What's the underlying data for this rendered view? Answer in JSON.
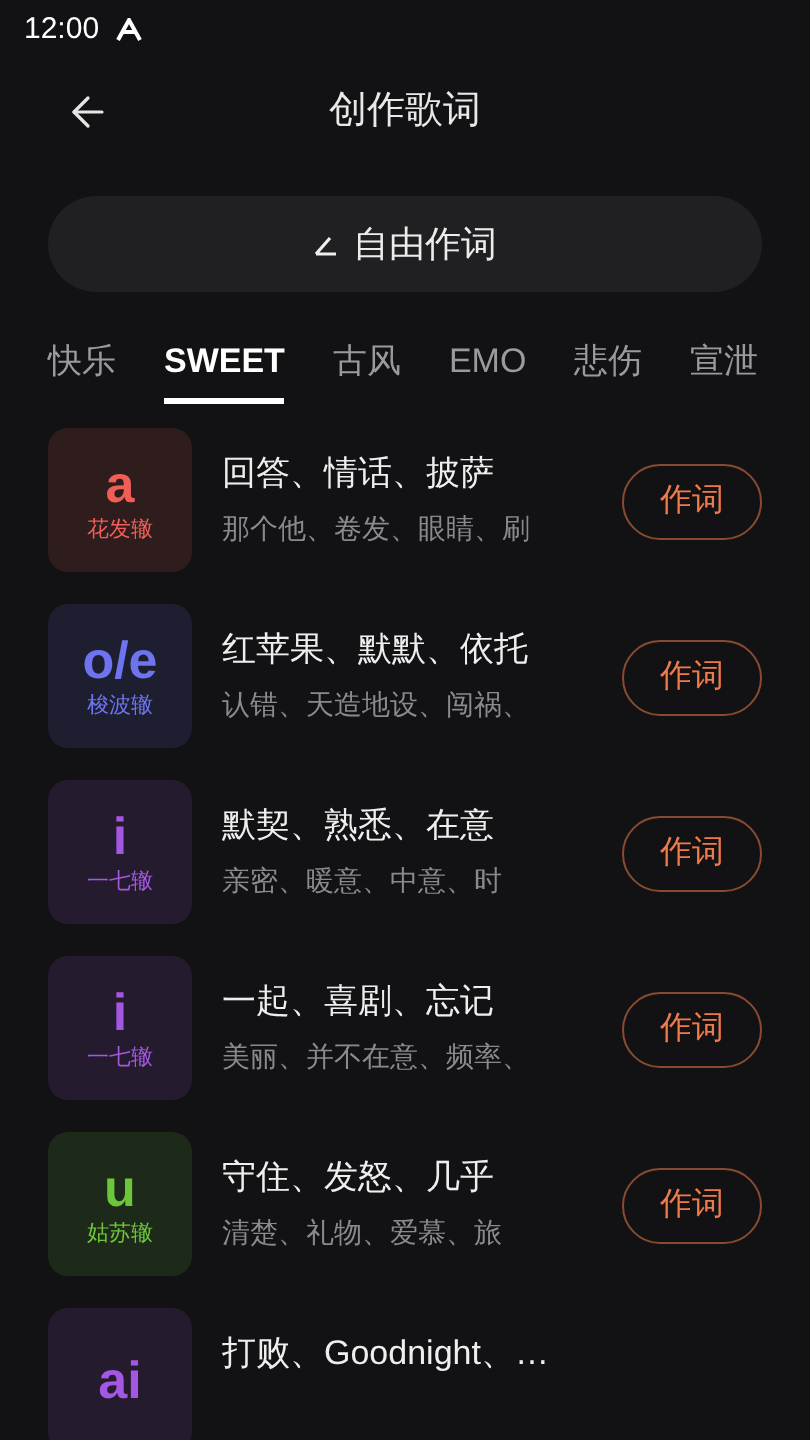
{
  "status_bar": {
    "time": "12:00"
  },
  "header": {
    "title": "创作歌词"
  },
  "free_button": {
    "label": "自由作词"
  },
  "tabs": [
    {
      "label": "快乐",
      "selected": false
    },
    {
      "label": "SWEET",
      "selected": true
    },
    {
      "label": "古风",
      "selected": false
    },
    {
      "label": "EMO",
      "selected": false
    },
    {
      "label": "悲伤",
      "selected": false
    },
    {
      "label": "宣泄",
      "selected": false
    }
  ],
  "rhymes": [
    {
      "rhyme": "a",
      "name": "花发辙",
      "color": "#ef5f58",
      "title": "回答、情话、披萨",
      "examples": "那个他、卷发、眼睛、刷",
      "button": "作词"
    },
    {
      "rhyme": "o/e",
      "name": "梭波辙",
      "color": "#6d74ee",
      "title": "红苹果、默默、依托",
      "examples": "认错、天造地设、闯祸、",
      "button": "作词"
    },
    {
      "rhyme": "i",
      "name": "一七辙",
      "color": "#a457e0",
      "title": "默契、熟悉、在意",
      "examples": "亲密、暖意、中意、时",
      "button": "作词"
    },
    {
      "rhyme": "i",
      "name": "一七辙",
      "color": "#a457e0",
      "title": "一起、喜剧、忘记",
      "examples": "美丽、并不在意、频率、",
      "button": "作词"
    },
    {
      "rhyme": "u",
      "name": "姑苏辙",
      "color": "#6cc53a",
      "title": "守住、发怒、几乎",
      "examples": "清楚、礼物、爱慕、旅",
      "button": "作词"
    },
    {
      "rhyme": "ai",
      "color": "#a457e0",
      "title": "打败、Goodnight、…"
    }
  ]
}
